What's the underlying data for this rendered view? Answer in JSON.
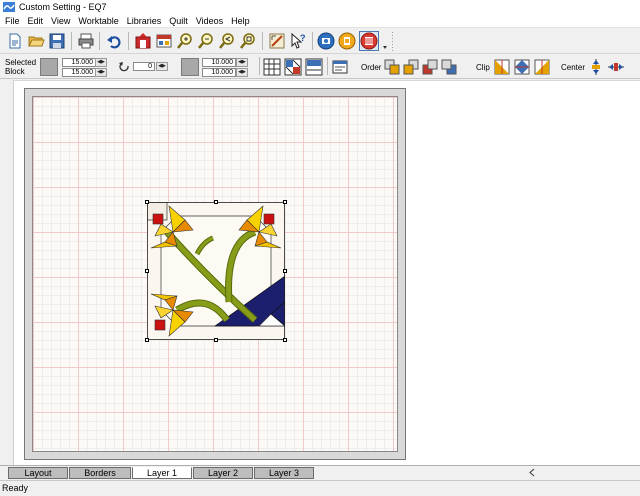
{
  "window": {
    "title": "Custom Setting - EQ7"
  },
  "menu": [
    "File",
    "Edit",
    "View",
    "Worktable",
    "Libraries",
    "Quilt",
    "Videos",
    "Help"
  ],
  "toolbar2": {
    "selected_label_line1": "Selected",
    "selected_label_line2": "Block",
    "width_value": "15.000",
    "height_value": "15.000",
    "rotation_value": "0",
    "size_w_value": "10.000",
    "size_h_value": "10.000",
    "order_label": "Order",
    "clip_label": "Clip",
    "center_label": "Center"
  },
  "tabs": [
    "Layout",
    "Borders",
    "Layer 1",
    "Layer 2",
    "Layer 3"
  ],
  "active_tab": "Layer 1",
  "status": {
    "text": "Ready"
  }
}
